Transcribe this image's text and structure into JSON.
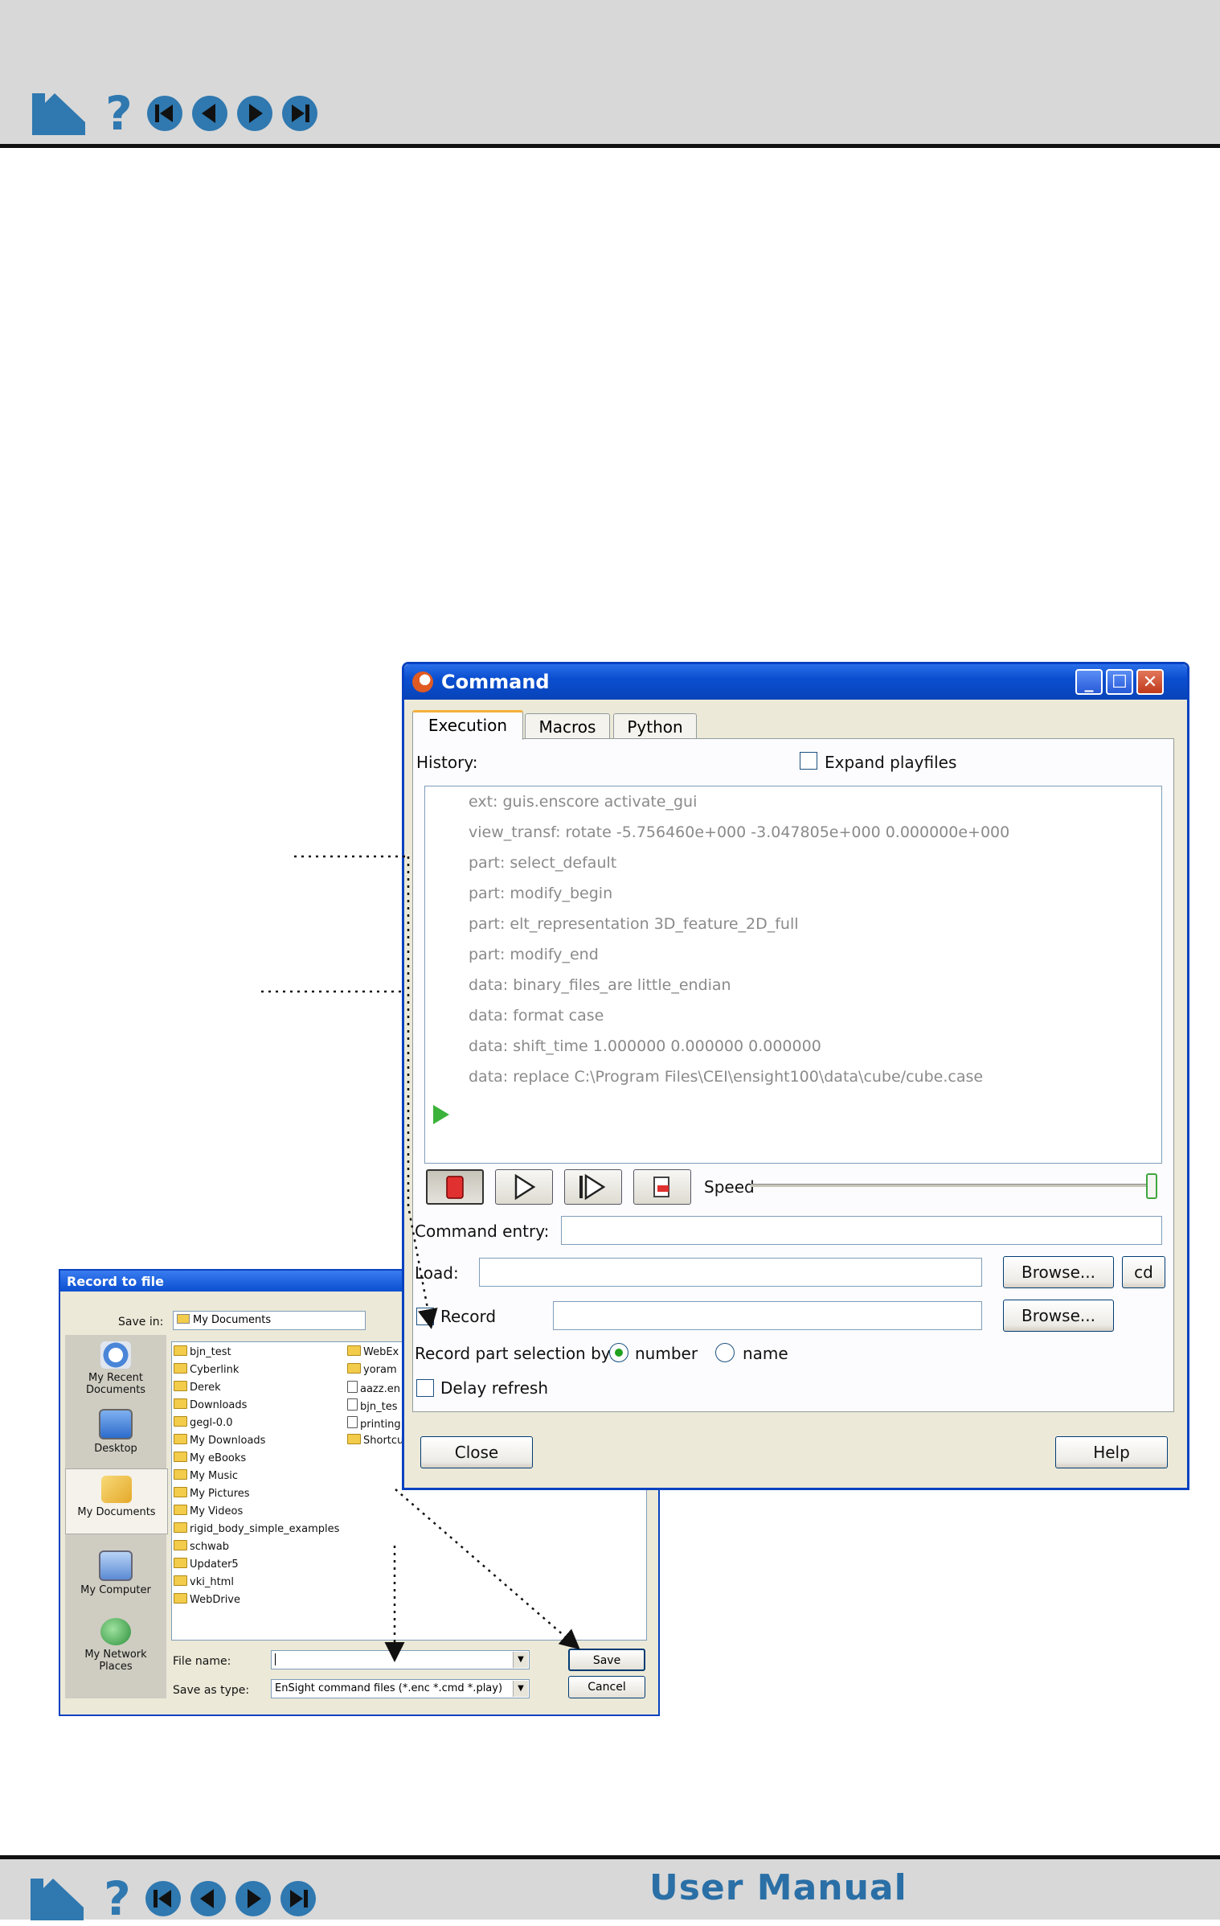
{
  "footer": {
    "manual_title": "User Manual"
  },
  "command_window": {
    "title": "Command",
    "tabs": [
      "Execution",
      "Macros",
      "Python"
    ],
    "history_label": "History:",
    "expand_playfiles_label": "Expand playfiles",
    "history": [
      "ext: guis.enscore activate_gui",
      "view_transf: rotate -5.756460e+000 -3.047805e+000 0.000000e+000",
      "part: select_default",
      "part: modify_begin",
      "part: elt_representation 3D_feature_2D_full",
      "part: modify_end",
      "data: binary_files_are little_endian",
      "data: format case",
      "data: shift_time 1.000000 0.000000 0.000000",
      "data: replace C:\\Program Files\\CEI\\ensight100\\data\\cube/cube.case"
    ],
    "speed_label": "Speed",
    "speed_value": 1.0,
    "command_entry_label": "Command entry:",
    "command_entry_value": "",
    "load_label": "Load:",
    "load_value": "",
    "browse_label": "Browse...",
    "cd_label": "cd",
    "record_label": "Record",
    "record_value": "",
    "record_part_selection_label": "Record part selection by:",
    "radio_number_label": "number",
    "radio_name_label": "name",
    "delay_refresh_label": "Delay refresh",
    "close_label": "Close",
    "help_label": "Help"
  },
  "record_dialog": {
    "title": "Record to file",
    "save_in_label": "Save in:",
    "save_in_value": "My Documents",
    "places": [
      "My Recent Documents",
      "Desktop",
      "My Documents",
      "My Computer",
      "My Network Places"
    ],
    "files_col1": [
      "bjn_test",
      "Cyberlink",
      "Derek",
      "Downloads",
      "gegl-0.0",
      "My Downloads",
      "My eBooks",
      "My Music",
      "My Pictures",
      "My Videos",
      "rigid_body_simple_examples",
      "schwab",
      "Updater5",
      "vki_html",
      "WebDrive"
    ],
    "files_col2": [
      "WebEx",
      "yoram",
      "aazz.en",
      "bjn_tes",
      "printing",
      "Shortcu"
    ],
    "file_name_label": "File name:",
    "file_name_value": "",
    "save_as_type_label": "Save as type:",
    "save_as_type_value": "EnSight command files (*.enc *.cmd *.play)",
    "save_label": "Save",
    "cancel_label": "Cancel"
  }
}
